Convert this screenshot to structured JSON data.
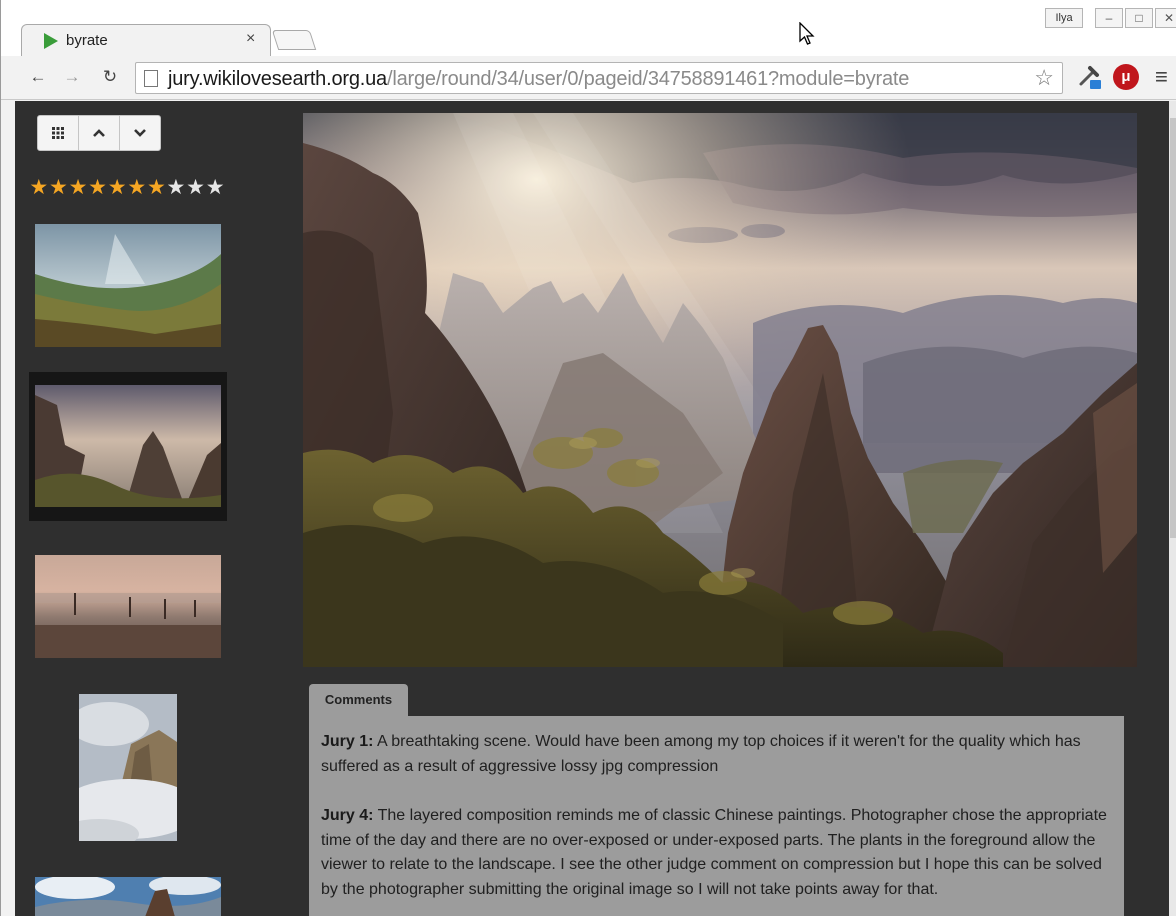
{
  "browser": {
    "tab_title": "byrate",
    "tab_close": "×",
    "user_badge": "Ilya",
    "window_min": "–",
    "window_max": "□",
    "window_close": "✕",
    "url_host": "jury.wikilovesearth.org.ua",
    "url_path": "/large/round/34/user/0/pageid/34758891461?module=byrate",
    "nav_back": "←",
    "nav_forward": "→",
    "nav_reload": "↻",
    "bookmark_icon": "star-outline-icon",
    "ext_ublock_label": "μ",
    "menu_icon": "≡"
  },
  "sidebar": {
    "buttons": [
      {
        "name": "grid-view-icon",
        "glyph": "▦"
      },
      {
        "name": "previous-up-icon",
        "glyph": "▲"
      },
      {
        "name": "next-down-icon",
        "glyph": "▼"
      }
    ],
    "rating": {
      "value": 7,
      "max": 10
    },
    "thumbnails": [
      {
        "name": "thumbnail-1",
        "desc": "valley with sun rays",
        "selected": false
      },
      {
        "name": "thumbnail-2",
        "desc": "rocky peaks at sunrise",
        "selected": true
      },
      {
        "name": "thumbnail-3",
        "desc": "misty marsh at dusk",
        "selected": false
      },
      {
        "name": "thumbnail-4",
        "desc": "rock above clouds",
        "selected": false
      },
      {
        "name": "thumbnail-5",
        "desc": "mountain with people",
        "selected": false
      }
    ]
  },
  "colors": {
    "page_bg": "#2f2f2f",
    "star_filled": "#f5a623",
    "star_empty": "#e6e6e6",
    "panel_bg": "#9c9c9c"
  },
  "comments": {
    "tab_label": "Comments",
    "items": [
      {
        "author": "Jury 1:",
        "text": " A breathtaking scene. Would have been among my top choices if it weren't for the quality which has suffered as a result of aggressive lossy jpg compression"
      },
      {
        "author": "Jury 4:",
        "text": " The layered composition reminds me of classic Chinese paintings. Photographer chose the appropriate time of the day and there are no over-exposed or under-exposed parts. The plants in the foreground allow the viewer to relate to the landscape. I see the other judge comment on compression but I hope this can be solved by the photographer submitting the original image so I will not take points away for that."
      }
    ]
  }
}
